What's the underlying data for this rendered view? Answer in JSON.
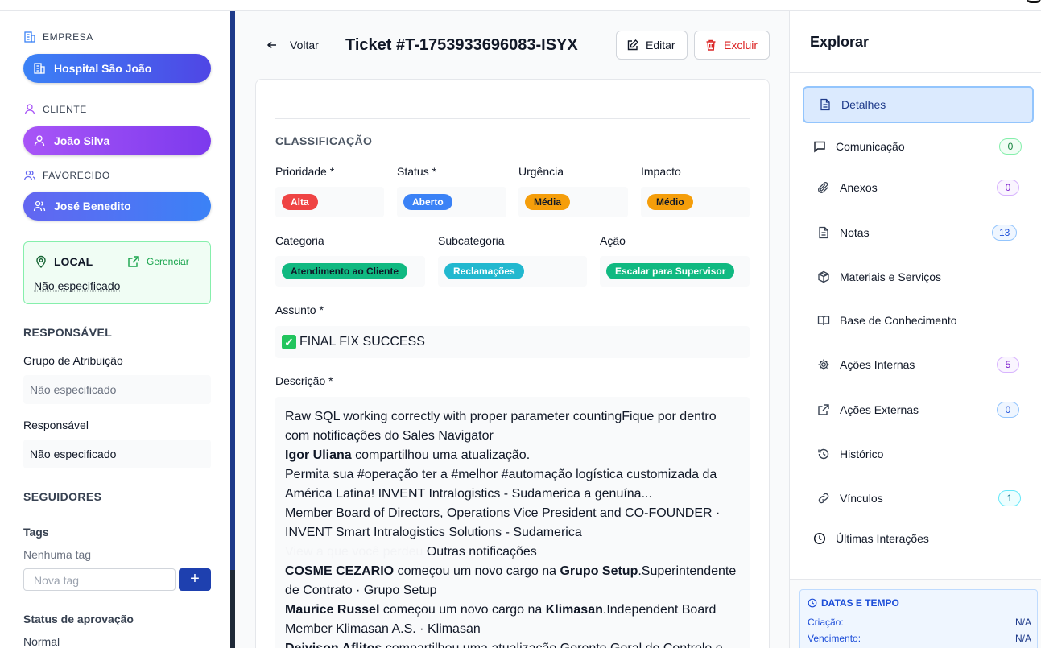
{
  "left": {
    "empresa": {
      "label": "EMPRESA",
      "value": "Hospital São João"
    },
    "cliente": {
      "label": "CLIENTE",
      "value": "João Silva"
    },
    "favorecido": {
      "label": "FAVORECIDO",
      "value": "José Benedito"
    },
    "local": {
      "label": "LOCAL",
      "manage": "Gerenciar",
      "value": "Não especificado"
    },
    "responsavel_title": "RESPONSÁVEL",
    "grupo_label": "Grupo de Atribuição",
    "grupo_value": "Não especificado",
    "responsavel_label": "Responsável",
    "responsavel_value": "Não especificado",
    "seguidores_title": "SEGUIDORES",
    "tags_label": "Tags",
    "tags_empty": "Nenhuma tag",
    "tag_placeholder": "Nova tag",
    "tag_add": "+",
    "aprovacao_label": "Status de aprovação",
    "aprovacao_value": "Normal"
  },
  "header": {
    "back": "Voltar",
    "title": "Ticket #T-1753933696083-ISYX",
    "edit": "Editar",
    "delete": "Excluir"
  },
  "classification": {
    "title": "CLASSIFICAÇÃO",
    "row1": [
      {
        "label": "Prioridade *",
        "value": "Alta",
        "color": "#ef4444",
        "text_color": "#ffffff"
      },
      {
        "label": "Status *",
        "value": "Aberto",
        "color": "#3b82f6",
        "text_color": "#ffffff"
      },
      {
        "label": "Urgência",
        "value": "Média",
        "color": "#f59e0b",
        "text_color": "#111827"
      },
      {
        "label": "Impacto",
        "value": "Médio",
        "color": "#f59e0b",
        "text_color": "#111827"
      }
    ],
    "row2": [
      {
        "label": "Categoria",
        "value": "Atendimento ao Cliente",
        "color": "#10b981",
        "text_color": "#111827"
      },
      {
        "label": "Subcategoria",
        "value": "Reclamações",
        "color": "#22b8cf",
        "text_color": "#ffffff"
      },
      {
        "label": "Ação",
        "value": "Escalar para Supervisor",
        "color": "#10b981",
        "text_color": "#ffffff"
      }
    ],
    "subject_label": "Assunto *",
    "subject_value": "FINAL FIX SUCCESS",
    "description_label": "Descrição *",
    "description": {
      "l1": "Raw SQL working correctly with proper parameter countingFique por dentro",
      "l2": "com notificações do Sales Navigator",
      "l3_b": "Igor Uliana",
      "l3": " compartilhou uma atualização.",
      "l4": "Permita sua #operação ter a #melhor #automação logística customizada da",
      "l5": "América Latina! INVENT Intralogistics - Sudamerica a genuína...",
      "l6": "Member Board of Directors, Operations Vice President and CO-FOUNDER ·",
      "l7": "INVENT Smart Intralogistics Solutions - Sudamerica",
      "l8_faint": "View a que você perdeu",
      "l8": "Outras notificações",
      "l9_b": "COSME CEZARIO",
      "l9": " começou um novo cargo na ",
      "l9_b2": "Grupo Setup",
      "l9_end": ".Superintendente",
      "l10": "de Contrato · Grupo Setup",
      "l11_b": "Maurice Russel",
      "l11": " começou um novo cargo na ",
      "l11_b2": "Klimasan",
      "l11_end": ".Independent Board",
      "l12": "Member Klimasan A.S. · Klimasan",
      "l13_b": "Deivison Aflitos",
      "l13": " compartilhou uma atualização.Gerente Geral de Controle e"
    }
  },
  "explorer": {
    "title": "Explorar",
    "items": [
      {
        "label": "Detalhes",
        "count": ""
      },
      {
        "label": "Comunicação",
        "count": "0"
      },
      {
        "label": "Anexos",
        "count": "0"
      },
      {
        "label": "Notas",
        "count": "13"
      },
      {
        "label": "Materiais e Serviços",
        "count": ""
      },
      {
        "label": "Base de Conhecimento",
        "count": ""
      },
      {
        "label": "Ações Internas",
        "count": "5"
      },
      {
        "label": "Ações Externas",
        "count": "0"
      },
      {
        "label": "Histórico",
        "count": ""
      },
      {
        "label": "Vínculos",
        "count": "1"
      },
      {
        "label": "Últimas Interações",
        "count": ""
      }
    ],
    "datas": {
      "title": "DATAS E TEMPO",
      "criacao_label": "Criação:",
      "criacao_value": "N/A",
      "vencimento_label": "Vencimento:",
      "vencimento_value": "N/A"
    }
  }
}
